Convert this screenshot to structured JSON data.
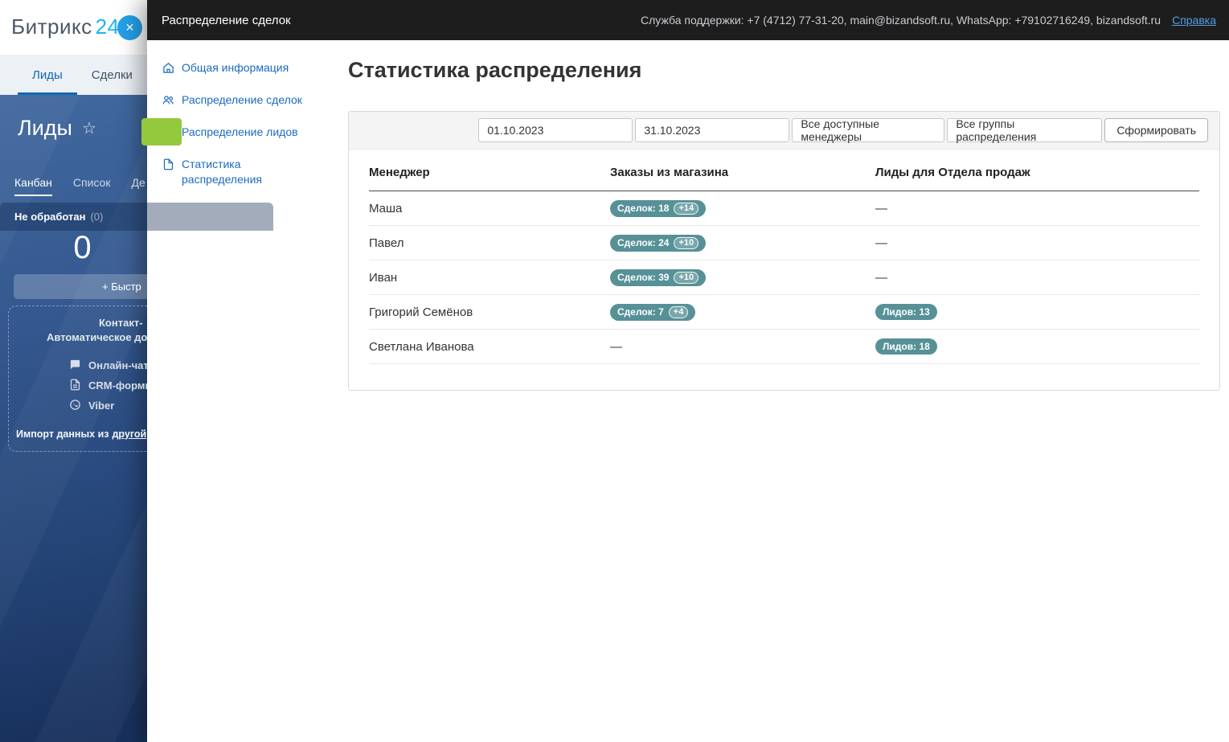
{
  "bg": {
    "logo_brand": "Битрикс",
    "logo_number": "24",
    "close_icon": "✕",
    "nav_tabs": [
      {
        "label": "Лиды"
      },
      {
        "label": "Сделки"
      }
    ],
    "page_title": "Лиды",
    "star_icon": "☆",
    "view_tabs": [
      {
        "label": "Канбан"
      },
      {
        "label": "Список"
      },
      {
        "label": "Де"
      }
    ],
    "kanban": {
      "column_title": "Не обработан",
      "column_count": "(0)",
      "total": "0",
      "quick_add": "+ Быстр"
    },
    "contact_box": {
      "line1": "Контакт-",
      "line2": "Автоматическое до",
      "items": [
        {
          "icon": "chat-icon",
          "label": "Онлайн-чат"
        },
        {
          "icon": "form-icon",
          "label": "CRM-формы"
        },
        {
          "icon": "viber-icon",
          "label": "Viber"
        }
      ]
    },
    "import_text": "Импорт данных из",
    "import_link": "другой"
  },
  "overlay": {
    "header": {
      "title": "Распределение сделок",
      "support": "Служба поддержки: +7 (4712) 77-31-20, main@bizandsoft.ru, WhatsApp: +79102716249, bizandsoft.ru",
      "help": "Справка"
    },
    "sidebar": {
      "items": [
        {
          "icon": "home-icon",
          "label": "Общая информация"
        },
        {
          "icon": "users-icon",
          "label": "Распределение сделок"
        },
        {
          "icon": "document-icon",
          "label": "Распределение лидов"
        },
        {
          "icon": "document-icon",
          "label": "Статистика распределения"
        }
      ]
    },
    "main": {
      "title": "Статистика распределения",
      "filters": {
        "date_from": "01.10.2023",
        "date_to": "31.10.2023",
        "managers": "Все доступные менеджеры",
        "groups": "Все группы распределения",
        "submit": "Сформировать"
      },
      "table": {
        "columns": [
          "Менеджер",
          "Заказы из магазина",
          "Лиды для Отдела продаж"
        ],
        "empty": "—",
        "rows": [
          {
            "manager": "Маша",
            "deals": "Сделок: 18",
            "delta": "+14",
            "leads": ""
          },
          {
            "manager": "Павел",
            "deals": "Сделок: 24",
            "delta": "+10",
            "leads": ""
          },
          {
            "manager": "Иван",
            "deals": "Сделок: 39",
            "delta": "+10",
            "leads": ""
          },
          {
            "manager": "Григорий Семёнов",
            "deals": "Сделок: 7",
            "delta": "+4",
            "leads": "Лидов: 13"
          },
          {
            "manager": "Светлана Иванова",
            "deals": "",
            "delta": "",
            "leads": "Лидов: 18"
          }
        ]
      }
    }
  },
  "colors": {
    "accent_blue": "#1b6ac1",
    "badge_teal": "#569197",
    "header_dark": "#1d1d1d",
    "bitrix_cyan": "#18b5f1",
    "green_button": "#94c83d",
    "help_link": "#559fe3"
  }
}
